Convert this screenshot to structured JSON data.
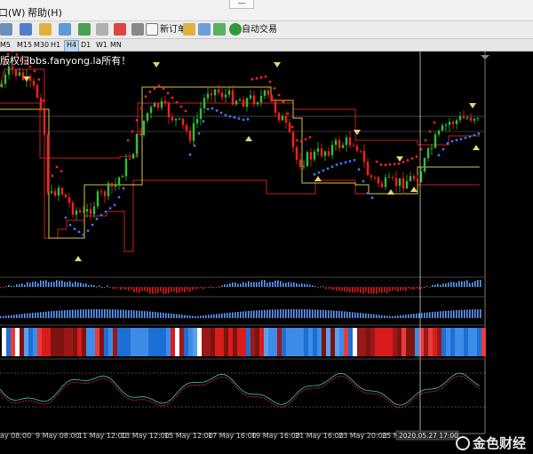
{
  "menubar": {
    "items": [
      {
        "label": "口(W)"
      },
      {
        "label": "帮助(H)"
      }
    ],
    "window_control": "—"
  },
  "toolbar": {
    "new_order": "新订单",
    "auto_trading": "自动交易"
  },
  "timeframes": [
    "M5",
    "M15",
    "M30",
    "H1",
    "H4",
    "D1",
    "W1",
    "MN"
  ],
  "active_timeframe": "H4",
  "chart": {
    "watermark_text": "版权归bbs.fanyong.la所有！",
    "time_labels": [
      "ay 08:00",
      "9 May 08:00",
      "11 May 12:00",
      "13 May 12:00",
      "15 May 12:00",
      "17 May 16:00",
      "19 May 16:00",
      "21 May 16:00",
      "23 May 20:00",
      "25 M"
    ],
    "crosshair_label": "2020.05.27 17:00",
    "colors": {
      "bull": "#2fc03a",
      "bear": "#ff2020",
      "psar_bull": "#3a7bff",
      "psar_bear": "#ff2020",
      "channel_upper": "#c81e1e",
      "channel_lower": "#d8c24a",
      "arrow": "#e8d472",
      "hist_pos": "#5e9cff",
      "hist_neg": "#e01818"
    }
  },
  "corner_watermark": "金色财经"
}
